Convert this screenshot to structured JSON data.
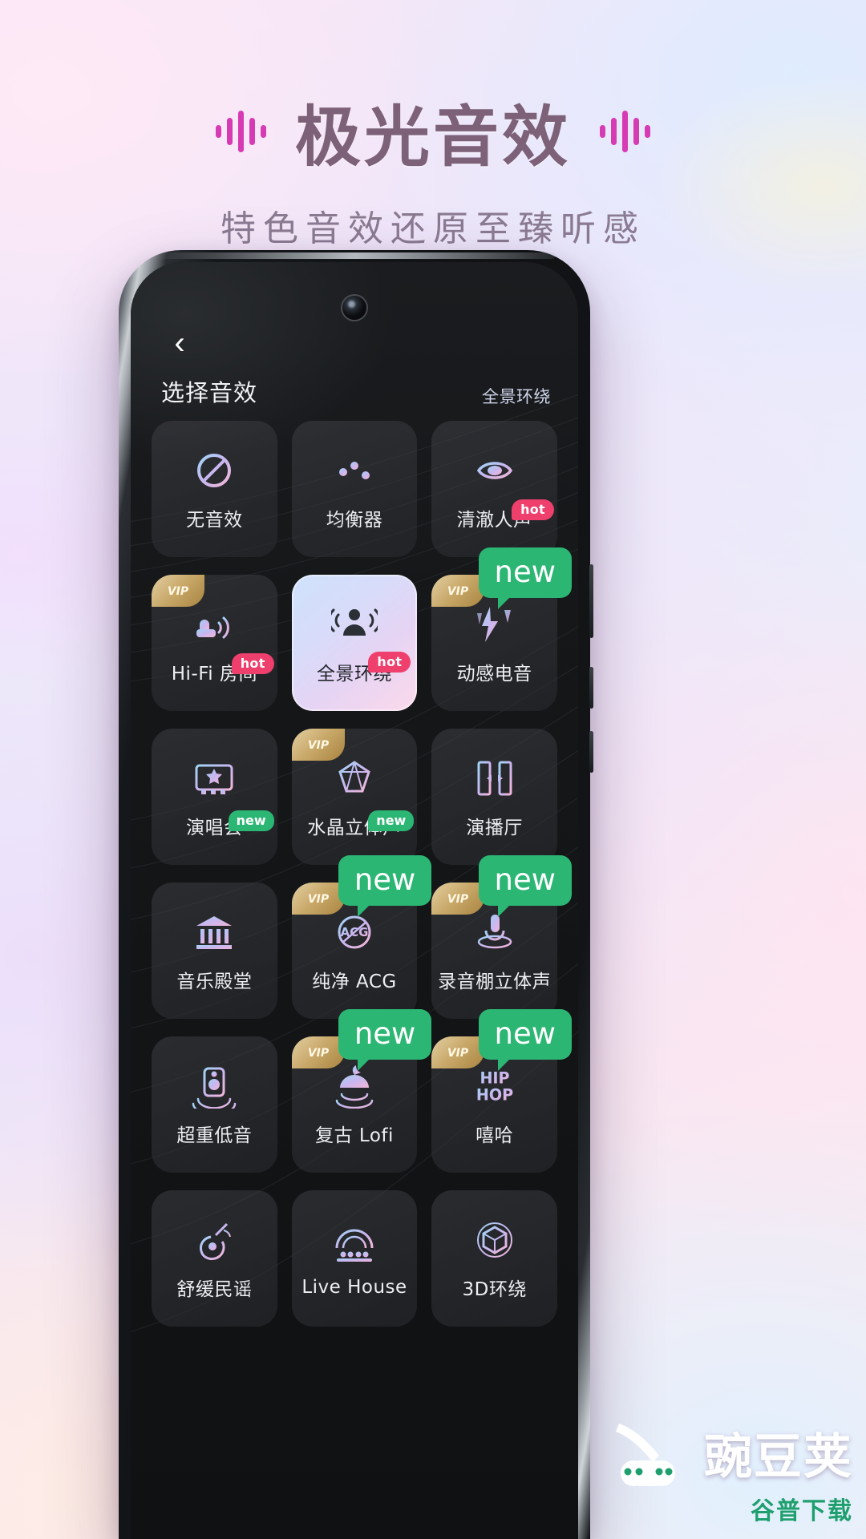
{
  "poster": {
    "title": "极光音效",
    "subtitle": "特色音效还原至臻听感",
    "title_color": "#7d6178",
    "wave_color": "#d63bb4",
    "accent_new": "#2bb673",
    "accent_hot": "#ee3f6d",
    "accent_vip": "#c9a96a"
  },
  "app": {
    "back_icon": "‹",
    "page_title": "选择音效",
    "current_effect": "全景环绕"
  },
  "badges": {
    "vip_label": "VIP",
    "hot_label": "hot",
    "new_small_label": "new",
    "new_large_label": "new"
  },
  "grid": {
    "tiles": [
      {
        "label": "无音效",
        "icon": "no-sound-icon",
        "vip": false,
        "hot": false,
        "new_small": false,
        "new_large": false,
        "selected": false
      },
      {
        "label": "均衡器",
        "icon": "equalizer-icon",
        "vip": false,
        "hot": false,
        "new_small": false,
        "new_large": false,
        "selected": false
      },
      {
        "label": "清澈人声",
        "icon": "clear-vocal-icon",
        "vip": false,
        "hot": true,
        "new_small": false,
        "new_large": false,
        "selected": false
      },
      {
        "label": "Hi-Fi 房间",
        "icon": "hifi-room-icon",
        "vip": true,
        "hot": true,
        "new_small": false,
        "new_large": false,
        "selected": false
      },
      {
        "label": "全景环绕",
        "icon": "surround-icon",
        "vip": false,
        "hot": true,
        "new_small": false,
        "new_large": false,
        "selected": true
      },
      {
        "label": "动感电音",
        "icon": "electronic-icon",
        "vip": true,
        "hot": false,
        "new_small": false,
        "new_large": true,
        "selected": false
      },
      {
        "label": "演唱会",
        "icon": "concert-icon",
        "vip": false,
        "hot": false,
        "new_small": true,
        "new_large": false,
        "selected": false
      },
      {
        "label": "水晶立体声",
        "icon": "crystal-stereo-icon",
        "vip": true,
        "hot": false,
        "new_small": true,
        "new_large": false,
        "selected": false
      },
      {
        "label": "演播厅",
        "icon": "studio-hall-icon",
        "vip": false,
        "hot": false,
        "new_small": false,
        "new_large": false,
        "selected": false
      },
      {
        "label": "音乐殿堂",
        "icon": "music-hall-icon",
        "vip": false,
        "hot": false,
        "new_small": false,
        "new_large": false,
        "selected": false
      },
      {
        "label": "纯净 ACG",
        "icon": "acg-icon",
        "vip": true,
        "hot": false,
        "new_small": false,
        "new_large": true,
        "selected": false
      },
      {
        "label": "录音棚立体声",
        "icon": "recording-studio-icon",
        "vip": true,
        "hot": false,
        "new_small": false,
        "new_large": true,
        "selected": false
      },
      {
        "label": "超重低音",
        "icon": "subwoofer-icon",
        "vip": false,
        "hot": false,
        "new_small": false,
        "new_large": false,
        "selected": false
      },
      {
        "label": "复古 Lofi",
        "icon": "lofi-icon",
        "vip": true,
        "hot": false,
        "new_small": false,
        "new_large": true,
        "selected": false
      },
      {
        "label": "嘻哈",
        "icon": "hiphop-icon",
        "vip": true,
        "hot": false,
        "new_small": false,
        "new_large": true,
        "selected": false
      },
      {
        "label": "舒缓民谣",
        "icon": "folk-guitar-icon",
        "vip": false,
        "hot": false,
        "new_small": false,
        "new_large": false,
        "selected": false
      },
      {
        "label": "Live House",
        "icon": "live-house-icon",
        "vip": false,
        "hot": false,
        "new_small": false,
        "new_large": false,
        "selected": false
      },
      {
        "label": "3D环绕",
        "icon": "3d-surround-icon",
        "vip": false,
        "hot": false,
        "new_small": false,
        "new_large": false,
        "selected": false
      }
    ]
  },
  "watermark": {
    "brand": "豌豆荚",
    "tagline": "谷普下载"
  }
}
